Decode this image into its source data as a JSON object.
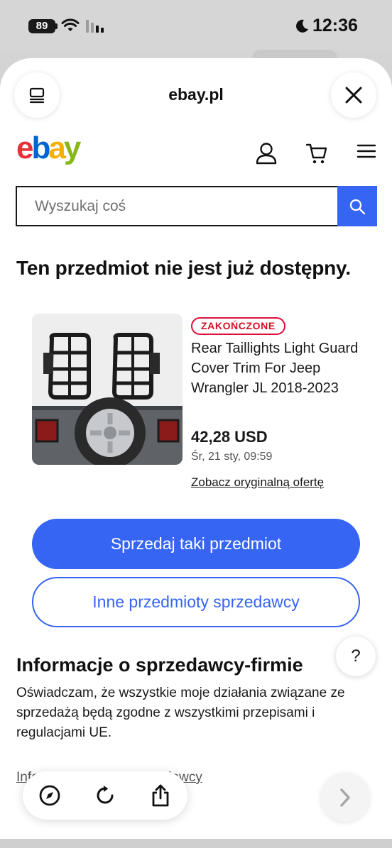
{
  "status_bar": {
    "battery": "89",
    "time": "12:36"
  },
  "browser": {
    "site": "ebay.pl"
  },
  "header": {
    "logo": {
      "e": "e",
      "b": "b",
      "a": "a",
      "y": "y"
    }
  },
  "search": {
    "placeholder": "Wyszukaj coś"
  },
  "page": {
    "heading": "Ten przedmiot nie jest już dostępny."
  },
  "item": {
    "badge": "ZAKOŃCZONE",
    "title": "Rear Taillights Light Guard Cover Trim For Jeep Wrangler JL 2018-2023",
    "price": "42,28 USD",
    "date": "Śr, 21 sty, 09:59",
    "original_link": "Zobacz oryginalną ofertę"
  },
  "actions": {
    "sell_label": "Sprzedaj taki przedmiot",
    "other_items_label": "Inne przedmioty sprzedawcy",
    "help_label": "?"
  },
  "seller_info": {
    "heading": "Informacje o sprzedawcy-firmie",
    "text": "Oświadczam, że wszystkie moje działania związane ze sprzedażą będą zgodne z wszystkimi przepisami i regulacjami UE.",
    "link": "Informacje prawne sprzedawcy"
  },
  "colors": {
    "accent": "#3665f3",
    "badge": "#e0103a",
    "logo_e": "#e53238",
    "logo_b": "#0064d2",
    "logo_a": "#f5af02",
    "logo_y": "#86b817"
  },
  "icons": [
    "tabs-icon",
    "close-icon",
    "user-icon",
    "cart-icon",
    "menu-icon",
    "search-icon",
    "compass-icon",
    "reload-icon",
    "share-icon",
    "chevron-right-icon"
  ]
}
